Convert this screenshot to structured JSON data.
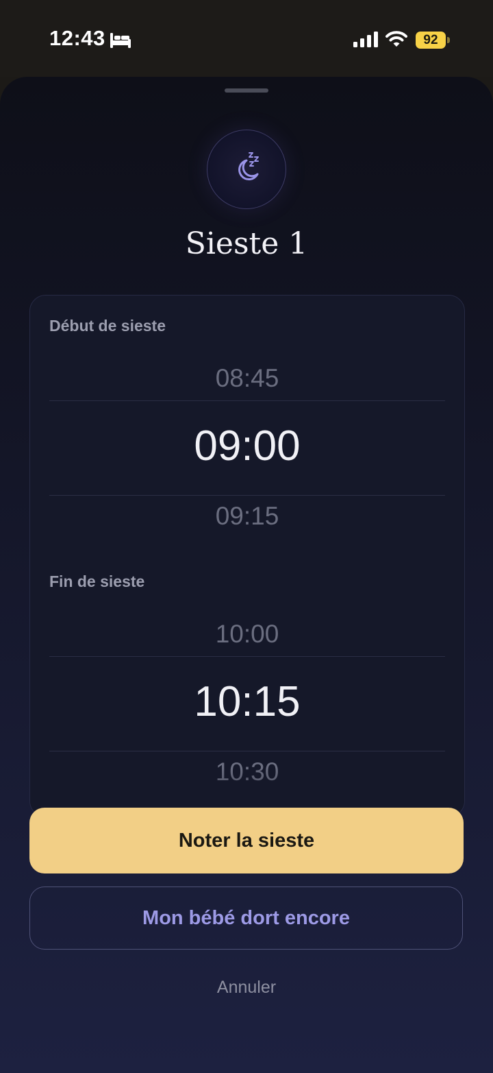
{
  "status_bar": {
    "time": "12:43",
    "sleep_icon": "bed-icon",
    "signal_icon": "cellular-signal-icon",
    "wifi_icon": "wifi-icon",
    "battery": "92",
    "battery_color": "#f7d247"
  },
  "sheet": {
    "icon": "moon-sleep-icon",
    "title": "Sieste 1",
    "start": {
      "label": "Début de sieste",
      "previous": "08:45",
      "selected": "09:00",
      "next": "09:15"
    },
    "end": {
      "label": "Fin de sieste",
      "previous": "10:00",
      "selected": "10:15",
      "next": "10:30"
    },
    "primary_button": "Noter la sieste",
    "secondary_button": "Mon bébé dort encore",
    "cancel": "Annuler",
    "accent_color": "#f2cf86",
    "secondary_color": "#9d9ae6"
  }
}
